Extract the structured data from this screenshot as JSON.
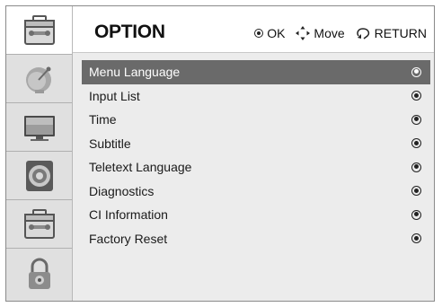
{
  "header": {
    "title": "OPTION",
    "ok_label": "OK",
    "move_label": "Move",
    "return_label": "RETURN"
  },
  "sidebar": {
    "items": [
      {
        "icon": "toolbox-icon",
        "active": true
      },
      {
        "icon": "satellite-dish-icon",
        "active": false
      },
      {
        "icon": "tv-monitor-icon",
        "active": false
      },
      {
        "icon": "speaker-icon",
        "active": false
      },
      {
        "icon": "toolbox-icon",
        "active": false
      },
      {
        "icon": "padlock-icon",
        "active": false
      }
    ]
  },
  "menu": {
    "items": [
      {
        "label": "Menu Language"
      },
      {
        "label": "Input List"
      },
      {
        "label": "Time"
      },
      {
        "label": "Subtitle"
      },
      {
        "label": "Teletext Language"
      },
      {
        "label": "Diagnostics"
      },
      {
        "label": "CI Information"
      },
      {
        "label": "Factory Reset"
      }
    ],
    "selected_index": 0
  },
  "colors": {
    "selected_row": "#6a6a6a",
    "panel_background": "#ececec",
    "header_background": "#ffffff"
  }
}
